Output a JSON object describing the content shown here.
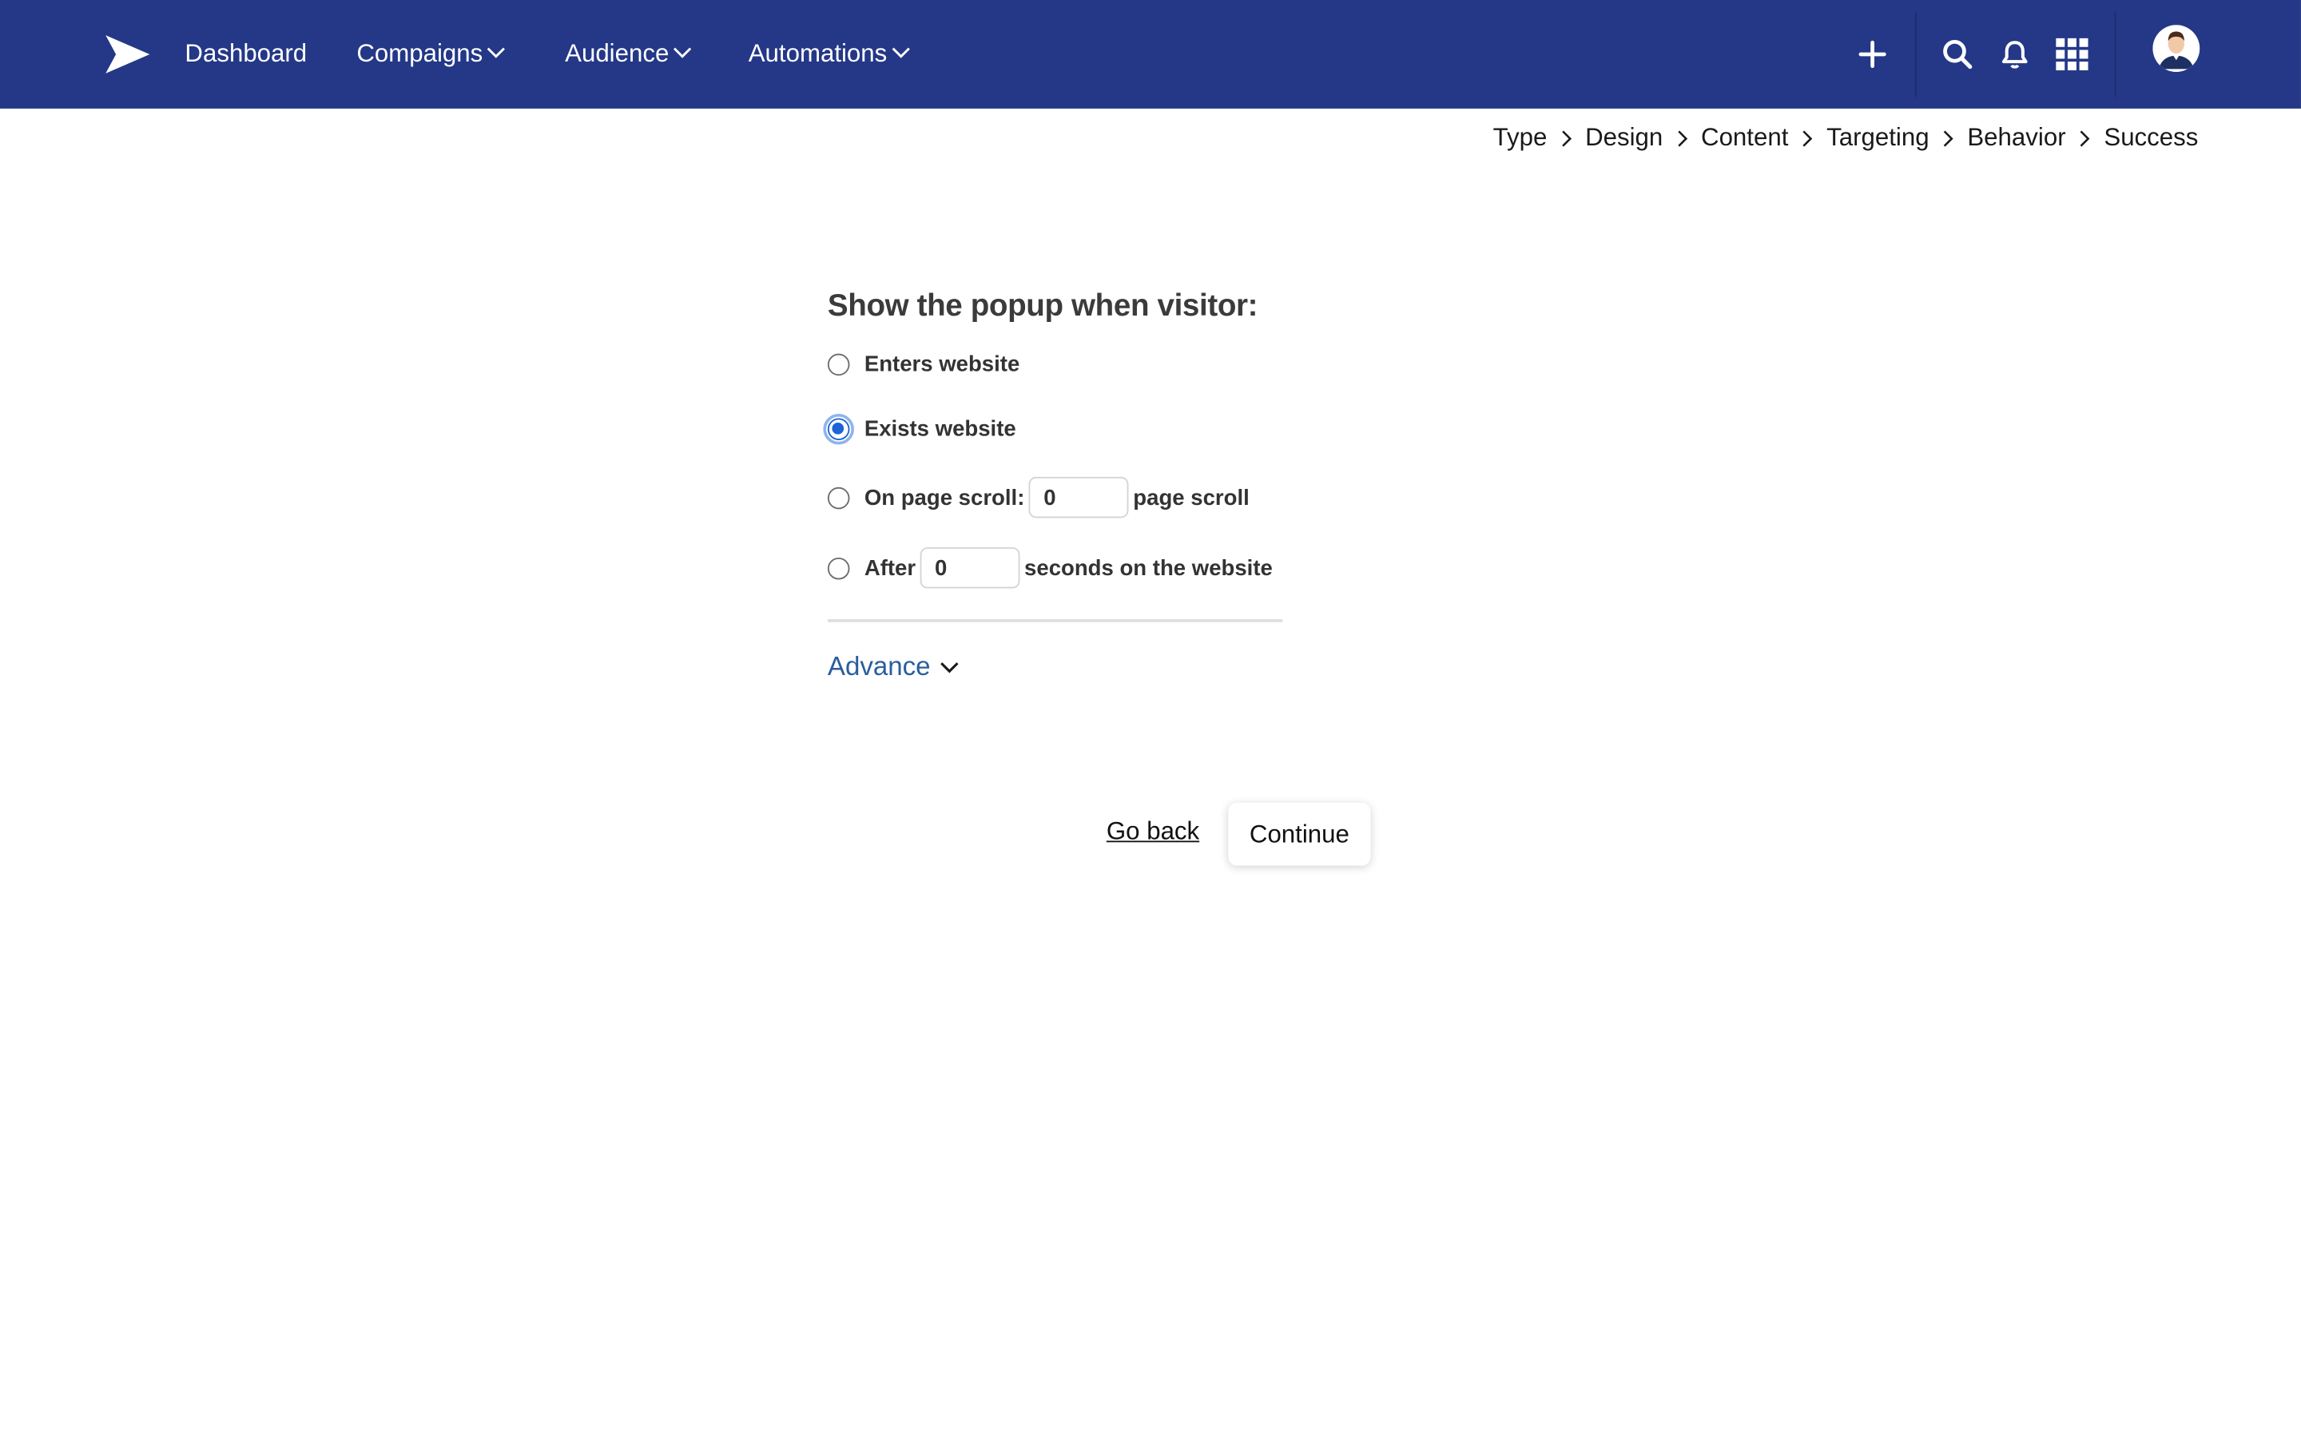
{
  "nav": {
    "logo_icon": "paper-plane-icon",
    "items": [
      {
        "label": "Dashboard",
        "has_dropdown": false
      },
      {
        "label": "Compaigns",
        "has_dropdown": true
      },
      {
        "label": "Audience",
        "has_dropdown": true
      },
      {
        "label": "Automations",
        "has_dropdown": true
      }
    ],
    "icons": [
      "plus-icon",
      "search-icon",
      "bell-icon",
      "grid-icon",
      "avatar"
    ]
  },
  "breadcrumb": [
    "Type",
    "Design",
    "Content",
    "Targeting",
    "Behavior",
    "Success"
  ],
  "form": {
    "heading": "Show the popup when visitor:",
    "options": {
      "enters": {
        "label": "Enters website",
        "checked": false
      },
      "exists": {
        "label": "Exists website",
        "checked": true
      },
      "scroll": {
        "label": "On page scroll:",
        "value": "0",
        "suffix": "page scroll",
        "checked": false
      },
      "after": {
        "label": "After",
        "value": "0",
        "suffix": "seconds on the website",
        "checked": false
      }
    },
    "advance_label": "Advance"
  },
  "actions": {
    "go_back": "Go back",
    "continue": "Continue"
  },
  "colors": {
    "nav_bg": "#243887",
    "accent": "#1b63d6",
    "link": "#2a5e9e"
  }
}
